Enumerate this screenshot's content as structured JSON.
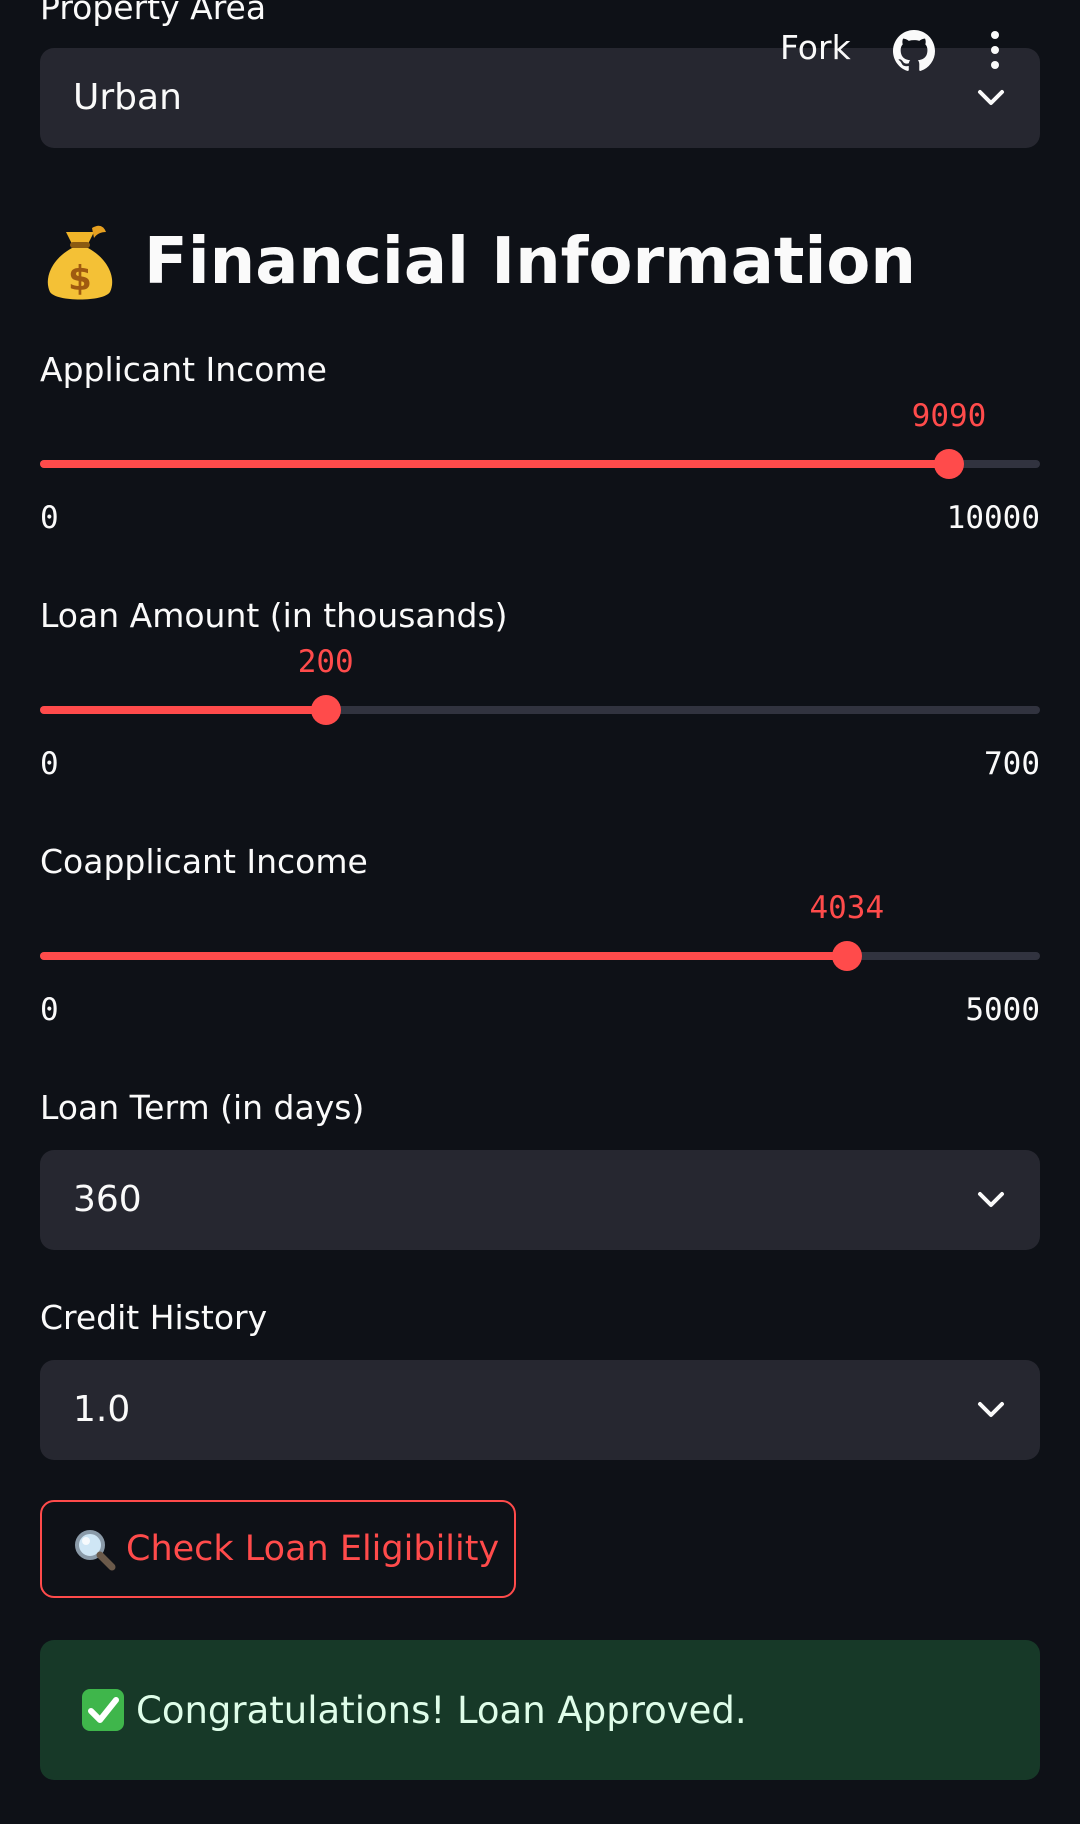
{
  "toolbar": {
    "fork_label": "Fork",
    "github_icon": "github-icon",
    "menu_icon": "kebab-menu-icon"
  },
  "property_area": {
    "label": "Property Area",
    "value": "Urban"
  },
  "section": {
    "emoji_icon": "money-bag-icon",
    "title": "Financial Information"
  },
  "sliders": [
    {
      "label": "Applicant Income",
      "value": "9090",
      "min": "0",
      "max": "10000",
      "fraction": 0.909
    },
    {
      "label": "Loan Amount (in thousands)",
      "value": "200",
      "min": "0",
      "max": "700",
      "fraction": 0.2857
    },
    {
      "label": "Coapplicant Income",
      "value": "4034",
      "min": "0",
      "max": "5000",
      "fraction": 0.8068
    }
  ],
  "loan_term": {
    "label": "Loan Term (in days)",
    "value": "360"
  },
  "credit_history": {
    "label": "Credit History",
    "value": "1.0"
  },
  "check_button": {
    "icon": "magnifier-icon",
    "label": "Check Loan Eligibility"
  },
  "result": {
    "icon": "check-mark-icon",
    "message": "Congratulations! Loan Approved."
  },
  "colors": {
    "background": "#0e1117",
    "accent": "#ff4b4b",
    "input_bg": "#262730",
    "success_bg": "#173928"
  }
}
